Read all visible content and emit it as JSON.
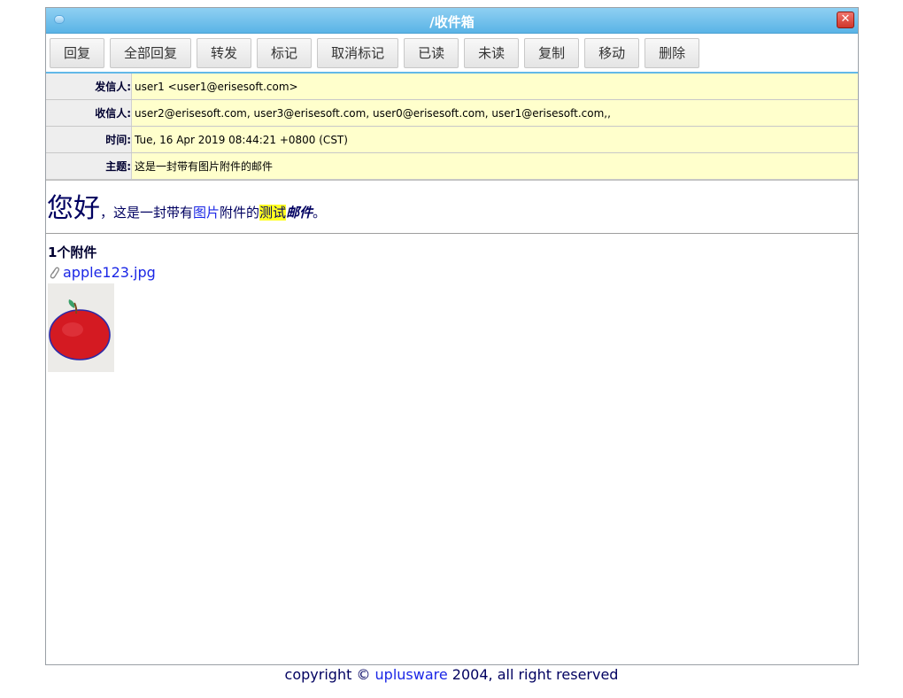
{
  "window": {
    "title": "/收件箱"
  },
  "toolbar": {
    "buttons": [
      "回复",
      "全部回复",
      "转发",
      "标记",
      "取消标记",
      "已读",
      "未读",
      "复制",
      "移动",
      "删除"
    ]
  },
  "headers": [
    {
      "label": "发信人:",
      "value": "user1 <user1@erisesoft.com>"
    },
    {
      "label": "收信人:",
      "value": "user2@erisesoft.com, user3@erisesoft.com, user0@erisesoft.com, user1@erisesoft.com,,"
    },
    {
      "label": "时间:",
      "value": "Tue, 16 Apr 2019 08:44:21 +0800 (CST)"
    },
    {
      "label": "主题:",
      "value": "这是一封带有图片附件的邮件"
    }
  ],
  "body": {
    "greeting": "您好",
    "part1": "，这是一封带有",
    "part2": "图片",
    "part3": "附件的",
    "part4": "测试",
    "part5": "邮件",
    "part6": "。"
  },
  "attachments": {
    "count_label": "1个附件",
    "file_name": "apple123.jpg"
  },
  "footer": {
    "prefix": "copyright © ",
    "link": "uplusware",
    "suffix": " 2004, all right reserved"
  }
}
